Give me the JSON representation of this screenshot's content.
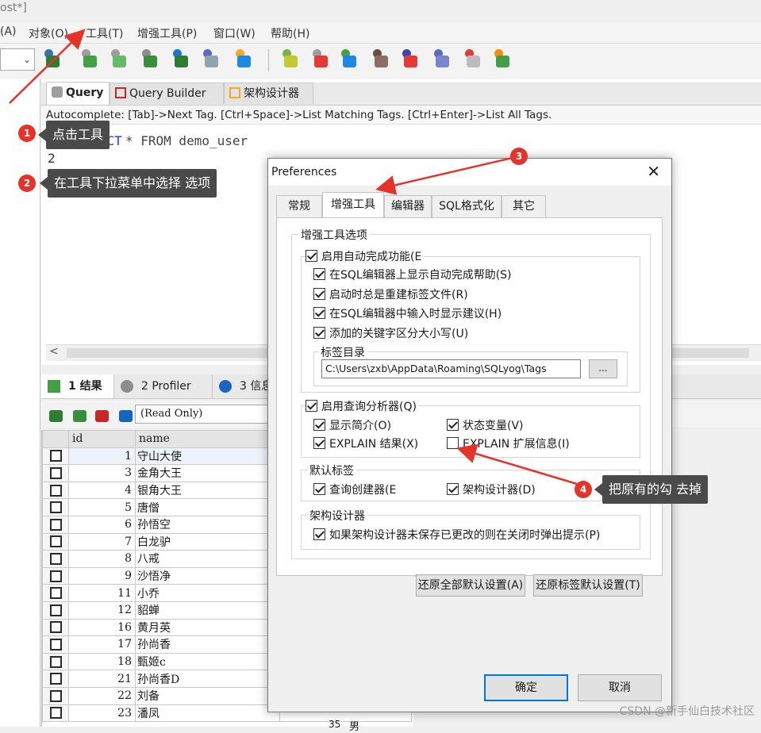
{
  "window": {
    "title_fragment": "ost*]"
  },
  "menu": [
    "(A)",
    "对象(O)",
    "工具(T)",
    "增强工具(P)",
    "窗口(W)",
    "帮助(H)"
  ],
  "editor": {
    "tabs": [
      {
        "label": "Query",
        "icon": "query-icon"
      },
      {
        "label": "Query Builder",
        "icon": "query-builder-icon"
      },
      {
        "label": "架构设计器",
        "icon": "schema-designer-icon"
      }
    ],
    "autocomplete_hint": "Autocomplete: [Tab]->Next Tag. [Ctrl+Space]->List Matching Tags. [Ctrl+Enter]->List All Tags.",
    "lines": [
      {
        "number": "1",
        "text_hidden": "SELECT",
        "rest": " * FROM demo_user"
      },
      {
        "number": "2",
        "text": ""
      }
    ]
  },
  "results": {
    "tabs": [
      {
        "label": "1 结果",
        "icon": "result-grid-icon"
      },
      {
        "label": "2 Profiler",
        "icon": "profiler-icon"
      },
      {
        "label": "3 信息",
        "icon": "info-icon"
      }
    ],
    "mode": "(Read Only)",
    "columns": [
      "id",
      "name"
    ],
    "rows": [
      {
        "id": "1",
        "name": "守山大使"
      },
      {
        "id": "3",
        "name": "金角大王"
      },
      {
        "id": "4",
        "name": "银角大王"
      },
      {
        "id": "5",
        "name": "唐僧"
      },
      {
        "id": "6",
        "name": "孙悟空"
      },
      {
        "id": "7",
        "name": "白龙驴"
      },
      {
        "id": "8",
        "name": "八戒"
      },
      {
        "id": "9",
        "name": "沙悟净"
      },
      {
        "id": "11",
        "name": "小乔"
      },
      {
        "id": "12",
        "name": "貂蝉"
      },
      {
        "id": "16",
        "name": "黄月英"
      },
      {
        "id": "17",
        "name": "孙尚香"
      },
      {
        "id": "18",
        "name": "甄姬c"
      },
      {
        "id": "21",
        "name": "孙尚香D"
      },
      {
        "id": "22",
        "name": "刘备"
      },
      {
        "id": "23",
        "name": "潘凤"
      }
    ],
    "partial_right": {
      "age": "35",
      "gender": "男"
    }
  },
  "dialog": {
    "title": "Preferences",
    "close": "✕",
    "tabs": [
      "常规",
      "增强工具",
      "编辑器",
      "SQL格式化",
      "其它"
    ],
    "active_tab": "增强工具",
    "section_title": "增强工具选项",
    "autocomplete_group": {
      "label": "启用自动完成功能(E",
      "checked": true,
      "options": [
        {
          "label": "在SQL编辑器上显示自动完成帮助(S)",
          "checked": true
        },
        {
          "label": "启动时总是重建标签文件(R)",
          "checked": true
        },
        {
          "label": "在SQL编辑器中输入时显示建议(H)",
          "checked": true
        },
        {
          "label": "添加的关键字区分大小写(U)",
          "checked": true
        }
      ],
      "tags_dir_label": "标签目录",
      "tags_dir_value": "C:\\Users\\zxb\\AppData\\Roaming\\SQLyog\\Tags",
      "browse_label": "..."
    },
    "analyzer_group": {
      "label": "启用查询分析器(Q)",
      "checked": true,
      "options": [
        {
          "label": "显示简介(O)",
          "checked": true
        },
        {
          "label": "状态变量(V)",
          "checked": true
        },
        {
          "label": "EXPLAIN 结果(X)",
          "checked": true
        },
        {
          "label": "EXPLAIN 扩展信息(I)",
          "checked": false
        }
      ]
    },
    "default_tags_group": {
      "label": "默认标签",
      "options": [
        {
          "label": "查询创建器(E",
          "checked": true
        },
        {
          "label": "架构设计器(D)",
          "checked": true
        }
      ]
    },
    "schema_group": {
      "label": "架构设计器",
      "options": [
        {
          "label": "如果架构设计器未保存已更改的则在关闭时弹出提示(P)",
          "checked": true
        }
      ]
    },
    "restore_all_label": "还原全部默认设置(A)",
    "restore_tags_label": "还原标签默认设置(T)",
    "ok_label": "确定",
    "cancel_label": "取消"
  },
  "annotations": [
    {
      "number": "1",
      "text": "点击工具"
    },
    {
      "number": "2",
      "text": "在工具下拉菜单中选择   选项"
    },
    {
      "number": "3",
      "text": ""
    },
    {
      "number": "4",
      "text": "把原有的勾 去掉"
    }
  ],
  "watermark": "CSDN @新手仙白技术社区",
  "colors": {
    "annotation_red": "#e5332a",
    "callout_bg": "#4a4a4a",
    "dialog_primary_border": "#0078d7"
  }
}
